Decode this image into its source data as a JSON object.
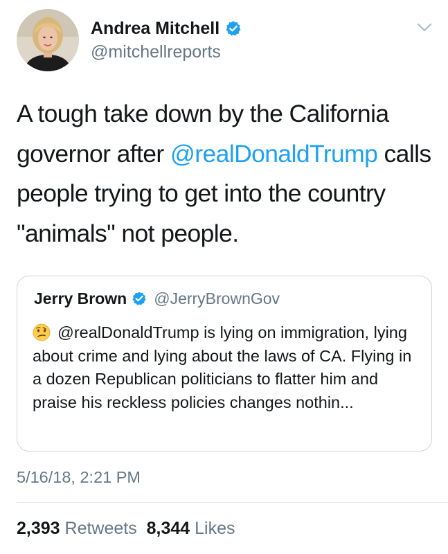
{
  "tweet": {
    "author": {
      "name": "Andrea Mitchell",
      "handle": "@mitchellreports",
      "verified": true
    },
    "text_before": "A tough take down by the California governor after ",
    "mention": "@realDonaldTrump",
    "text_after": " calls people trying to get into the country \"animals\" not people.",
    "timestamp": "5/16/18, 2:21 PM",
    "stats": {
      "retweets_count": "2,393",
      "retweets_label": "Retweets",
      "likes_count": "8,344",
      "likes_label": "Likes"
    }
  },
  "quoted_tweet": {
    "author": {
      "name": "Jerry Brown",
      "handle": "@JerryBrownGov",
      "verified": true
    },
    "emoji": "confused-face",
    "text": "@realDonaldTrump is lying on immigration, lying about crime and lying about the laws of CA. Flying in a dozen Republican politicians to flatter him and praise his reckless policies changes nothin..."
  },
  "colors": {
    "accent": "#1da1f2",
    "secondary_text": "#657786",
    "primary_text": "#14171a",
    "border": "#ccd6dd"
  }
}
